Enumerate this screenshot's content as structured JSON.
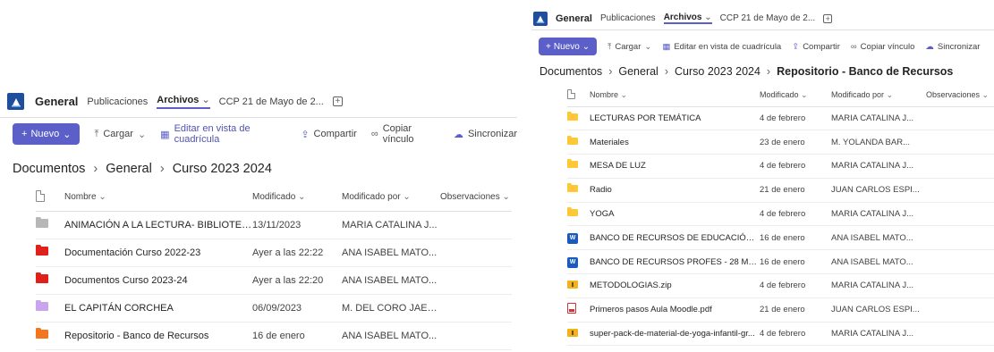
{
  "colors": {
    "accent": "#5b5fc7",
    "folder_gray": "#b7b7b7",
    "folder_red": "#e0201b",
    "folder_purple": "#c8a5ec",
    "folder_orange": "#f4751f",
    "folder_yellow": "#ffc736"
  },
  "left": {
    "topbar": {
      "channel": "General",
      "tabs": [
        "Publicaciones",
        "Archivos",
        "CCP 21 de Mayo de 2..."
      ],
      "active_tab_chevron": "⌵"
    },
    "toolbar": {
      "new_label": "Nuevo",
      "upload_label": "Cargar",
      "grid_label": "Editar en vista de cuadrícula",
      "share_label": "Compartir",
      "copy_label": "Copiar vínculo",
      "sync_label": "Sincronizar"
    },
    "breadcrumb": [
      "Documentos",
      "General",
      "Curso 2023 2024"
    ],
    "columns": {
      "name": "Nombre",
      "modified": "Modificado",
      "modified_by": "Modificado por",
      "notes": "Observaciones"
    },
    "rows": [
      {
        "name": "ANIMACIÓN A LA LECTURA- BIBLIOTECA",
        "modified": "13/11/2023",
        "by": "MARIA CATALINA J...",
        "icon": "folder-icon",
        "color": "#b7b7b7"
      },
      {
        "name": "Documentación Curso 2022-23",
        "modified": "Ayer a las 22:22",
        "by": "ANA ISABEL MATO...",
        "icon": "folder-icon",
        "color": "#e0201b"
      },
      {
        "name": "Documentos Curso 2023-24",
        "modified": "Ayer a las 22:20",
        "by": "ANA ISABEL MATO...",
        "icon": "folder-icon",
        "color": "#e0201b"
      },
      {
        "name": "EL CAPITÁN CORCHEA",
        "modified": "06/09/2023",
        "by": "M. DEL CORO JAEN...",
        "icon": "folder-icon",
        "color": "#c8a5ec"
      },
      {
        "name": "Repositorio - Banco de Recursos",
        "modified": "16 de enero",
        "by": "ANA ISABEL MATO...",
        "icon": "folder-icon",
        "color": "#f4751f"
      }
    ]
  },
  "right": {
    "topbar": {
      "channel": "General",
      "tabs": [
        "Publicaciones",
        "Archivos",
        "CCP 21 de Mayo de 2..."
      ]
    },
    "toolbar": {
      "new_label": "Nuevo",
      "upload_label": "Cargar",
      "grid_label": "Editar en vista de cuadrícula",
      "share_label": "Compartir",
      "copy_label": "Copiar vínculo",
      "sync_label": "Sincronizar"
    },
    "breadcrumb": [
      "Documentos",
      "General",
      "Curso 2023 2024",
      "Repositorio - Banco de Recursos"
    ],
    "columns": {
      "name": "Nombre",
      "modified": "Modificado",
      "modified_by": "Modificado por",
      "notes": "Observaciones"
    },
    "rows": [
      {
        "name": "LECTURAS POR TEMÁTICA",
        "modified": "4 de febrero",
        "by": "MARIA CATALINA J...",
        "icon": "folder-icon",
        "color": "#ffc736"
      },
      {
        "name": "Materiales",
        "modified": "23 de enero",
        "by": "M. YOLANDA BAR...",
        "icon": "folder-icon",
        "color": "#ffc736"
      },
      {
        "name": "MESA DE LUZ",
        "modified": "4 de febrero",
        "by": "MARIA CATALINA J...",
        "icon": "folder-icon",
        "color": "#ffc736"
      },
      {
        "name": "Radio",
        "modified": "21 de enero",
        "by": "JUAN CARLOS ESPI...",
        "icon": "folder-icon",
        "color": "#ffc736"
      },
      {
        "name": "YOGA",
        "modified": "4 de febrero",
        "by": "MARIA CATALINA J...",
        "icon": "folder-icon",
        "color": "#ffc736"
      },
      {
        "name": "BANCO DE RECURSOS DE EDUCACIÓN INF...",
        "modified": "16 de enero",
        "by": "ANA ISABEL MATO...",
        "icon": "word-doc-icon",
        "color": "#185abd"
      },
      {
        "name": "BANCO DE RECURSOS PROFES - 28 MAYO....",
        "modified": "16 de enero",
        "by": "ANA ISABEL MATO...",
        "icon": "word-doc-icon",
        "color": "#185abd"
      },
      {
        "name": "METODOLOGIAS.zip",
        "modified": "4 de febrero",
        "by": "MARIA CATALINA J...",
        "icon": "zip-icon",
        "color": "#f2b21b"
      },
      {
        "name": "Primeros pasos Aula Moodle.pdf",
        "modified": "21 de enero",
        "by": "JUAN CARLOS ESPI...",
        "icon": "pdf-icon",
        "color": "#d13438"
      },
      {
        "name": "super-pack-de-material-de-yoga-infantil-gr...",
        "modified": "4 de febrero",
        "by": "MARIA CATALINA J...",
        "icon": "zip-icon",
        "color": "#f2b21b"
      }
    ]
  }
}
